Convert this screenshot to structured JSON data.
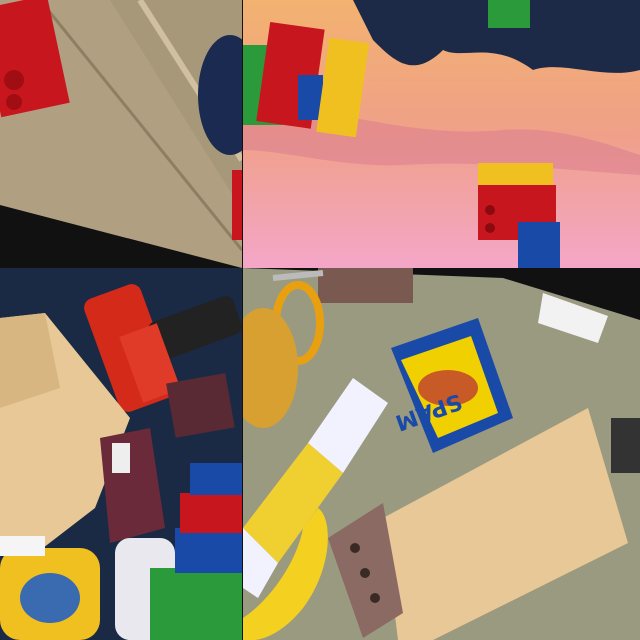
{
  "image": {
    "description_words": [],
    "quadrants": [
      {
        "id": "top-left",
        "scene": "floor-with-toy-brick"
      },
      {
        "id": "top-right",
        "scene": "sunset-sky-with-blocks"
      },
      {
        "id": "bottom-left",
        "scene": "toys-and-tools"
      },
      {
        "id": "bottom-right",
        "scene": "objects-on-carpet"
      }
    ],
    "visible_text": [
      "SPAM"
    ],
    "colors": {
      "floor": "#a8987a",
      "sky_top": "#f2b270",
      "sky_bottom": "#f4a6c8",
      "carpet": "#9a9a80",
      "wood": "#e8c896",
      "brick_red": "#c8161e",
      "brick_yellow": "#f0c020",
      "brick_green": "#2a9a3a",
      "brick_blue": "#1a4aa8",
      "drill": "#d42a1a",
      "can_yellow": "#f0d000",
      "banana": "#f4d020",
      "blue_bg": "#1a2a44"
    }
  }
}
